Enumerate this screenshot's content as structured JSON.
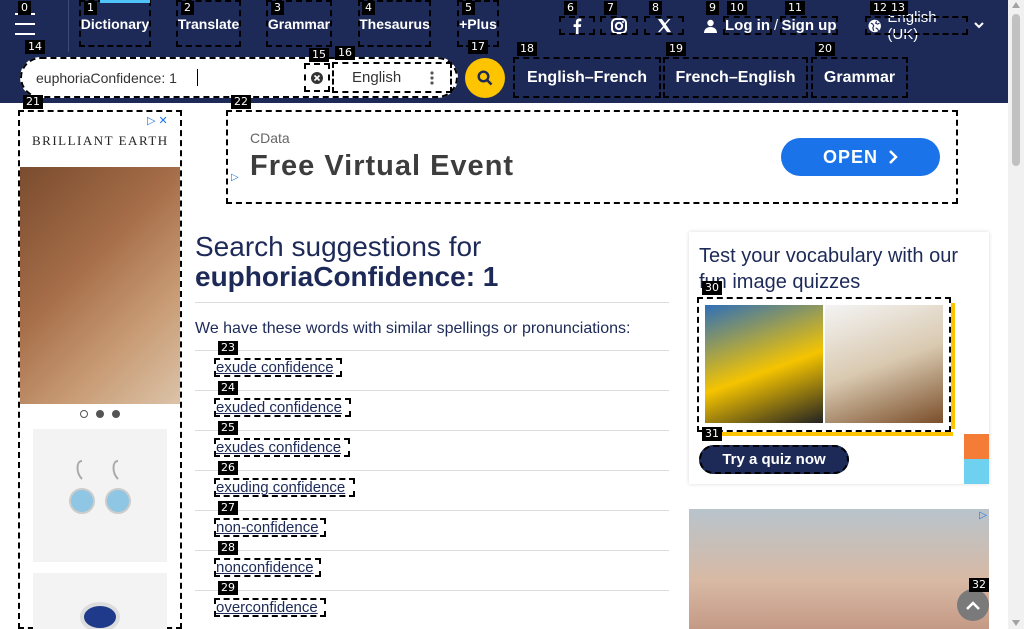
{
  "nav": {
    "links": [
      "Dictionary",
      "Translate",
      "Grammar",
      "Thesaurus",
      "+Plus"
    ],
    "login": "Log in",
    "separator": "/",
    "signup": "Sign up",
    "language": "English (UK)"
  },
  "search": {
    "value": "euphoriaConfidence: 1",
    "dictionary": "English",
    "quick_links": [
      "English–French",
      "French–English",
      "Grammar"
    ]
  },
  "ads": {
    "top_brand": "CData",
    "top_headline": "Free Virtual Event",
    "top_cta": "OPEN",
    "left_brand": "BRILLIANT EARTH"
  },
  "main": {
    "heading_prefix": "Search suggestions for",
    "heading_query": "euphoriaConfidence: 1",
    "intro": "We have these words with similar spellings or pronunciations:",
    "suggestions": [
      "exude confidence",
      "exuded confidence",
      "exudes confidence",
      "exuding confidence",
      "non-confidence",
      "nonconfidence",
      "overconfidence"
    ]
  },
  "quiz": {
    "title": "Test your vocabulary with our fun image quizzes",
    "button": "Try a quiz now"
  },
  "marks": [
    "0",
    "1",
    "2",
    "3",
    "4",
    "5",
    "6",
    "7",
    "8",
    "9",
    "10",
    "11",
    "12",
    "13",
    "14",
    "15",
    "16",
    "17",
    "18",
    "19",
    "20",
    "21",
    "22",
    "23",
    "24",
    "25",
    "26",
    "27",
    "28",
    "29",
    "30",
    "31",
    "32"
  ],
  "colors": {
    "navy": "#1d2a57",
    "yellow": "#fec400",
    "accent_blue": "#1a73e8"
  }
}
